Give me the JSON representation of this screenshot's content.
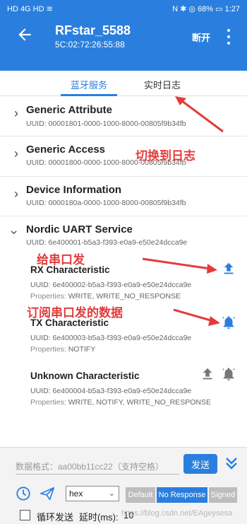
{
  "status_bar": {
    "left_text": "HD 4G HD ≋",
    "right_text": "N ✱ ◎ 68% ▭ 1:27"
  },
  "header": {
    "title": "RFstar_5588",
    "subtitle": "5C:02:72:26:55:88",
    "disconnect_label": "断开"
  },
  "tabs": [
    {
      "label": "蓝牙服务",
      "active": true
    },
    {
      "label": "实时日志",
      "active": false
    }
  ],
  "services": [
    {
      "name": "Generic Attribute",
      "uuid": "UUID: 00001801-0000-1000-8000-00805f9b34fb",
      "expanded": false
    },
    {
      "name": "Generic Access",
      "uuid": "UUID: 00001800-0000-1000-8000-00805f9b34fb",
      "expanded": false
    },
    {
      "name": "Device Information",
      "uuid": "UUID: 0000180a-0000-1000-8000-00805f9b34fb",
      "expanded": false
    },
    {
      "name": "Nordic UART Service",
      "uuid": "UUID: 6e400001-b5a3-f393-e0a9-e50e24dcca9e",
      "expanded": true
    }
  ],
  "characteristics": [
    {
      "name": "RX Characteristic",
      "uuid": "UUID: 6e400002-b5a3-f393-e0a9-e50e24dcca9e",
      "properties_label": "Properties:",
      "properties": "WRITE, WRITE_NO_RESPONSE"
    },
    {
      "name": "TX Characteristic",
      "uuid": "UUID: 6e400003-b5a3-f393-e0a9-e50e24dcca9e",
      "properties_label": "Properties:",
      "properties": "NOTIFY"
    },
    {
      "name": "Unknown Characteristic",
      "uuid": "UUID: 6e400004-b5a3-f393-e0a9-e50e24dcca9e",
      "properties_label": "Properties:",
      "properties": "WRITE, NOTIFY, WRITE_NO_RESPONSE"
    }
  ],
  "annotations": {
    "switch_log": "切换到日志",
    "send_serial": "给串口发",
    "subscribe_serial": "订阅串口发的数据",
    "color": "#e43b3b"
  },
  "send_panel": {
    "placeholder": "数据格式：aa00bb11cc22（支持空格）",
    "send_label": "发送",
    "format_value": "hex",
    "write_types": [
      "Default",
      "No Response",
      "Signed"
    ],
    "loop_label": "循环发送",
    "delay_label": "延时(ms):",
    "delay_value": "10",
    "watermark": "https://blog.csdn.net/EAgeysesa"
  },
  "colors": {
    "primary": "#2a7fde",
    "accent_red": "#e43b3b"
  }
}
